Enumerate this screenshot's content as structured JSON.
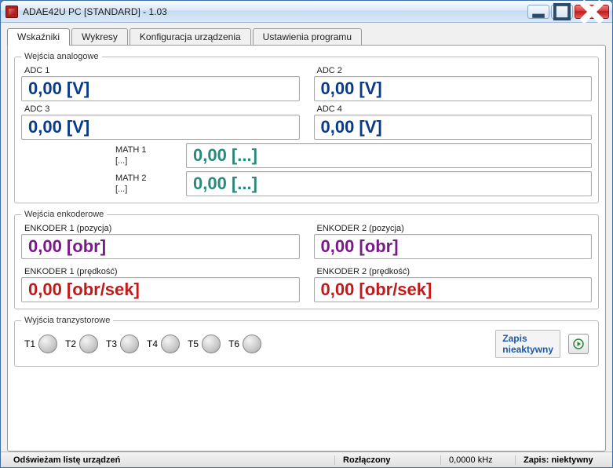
{
  "window": {
    "title": "ADAE42U PC [STANDARD] - 1.03"
  },
  "tabs": {
    "t0": "Wskaźniki",
    "t1": "Wykresy",
    "t2": "Konfiguracja urządzenia",
    "t3": "Ustawienia programu"
  },
  "analog": {
    "legend": "Wejścia analogowe",
    "adc1_label": "ADC 1",
    "adc1_value": "0,00 [V]",
    "adc2_label": "ADC 2",
    "adc2_value": "0,00 [V]",
    "adc3_label": "ADC 3",
    "adc3_value": "0,00 [V]",
    "adc4_label": "ADC 4",
    "adc4_value": "0,00 [V]",
    "math1_label_line1": "MATH 1",
    "math1_label_line2": "[...]",
    "math1_value": "0,00 [...]",
    "math2_label_line1": "MATH 2",
    "math2_label_line2": "[...]",
    "math2_value": "0,00 [...]"
  },
  "encoder": {
    "legend": "Wejścia enkoderowe",
    "e1p_label": "ENKODER 1 (pozycja)",
    "e1p_value": "0,00 [obr]",
    "e2p_label": "ENKODER 2 (pozycja)",
    "e2p_value": "0,00 [obr]",
    "e1s_label": "ENKODER 1 (prędkość)",
    "e1s_value": "0,00 [obr/sek]",
    "e2s_label": "ENKODER 2 (prędkość)",
    "e2s_value": "0,00 [obr/sek]"
  },
  "transistor": {
    "legend": "Wyjścia tranzystorowe",
    "t1": "T1",
    "t2": "T2",
    "t3": "T3",
    "t4": "T4",
    "t5": "T5",
    "t6": "T6",
    "zapis_line1": "Zapis",
    "zapis_line2": "nieaktywny"
  },
  "status": {
    "s1": "Odświeżam listę urządzeń",
    "s2": "Rozłączony",
    "s3": "0,0000 kHz",
    "s4": "Zapis: niektywny"
  }
}
